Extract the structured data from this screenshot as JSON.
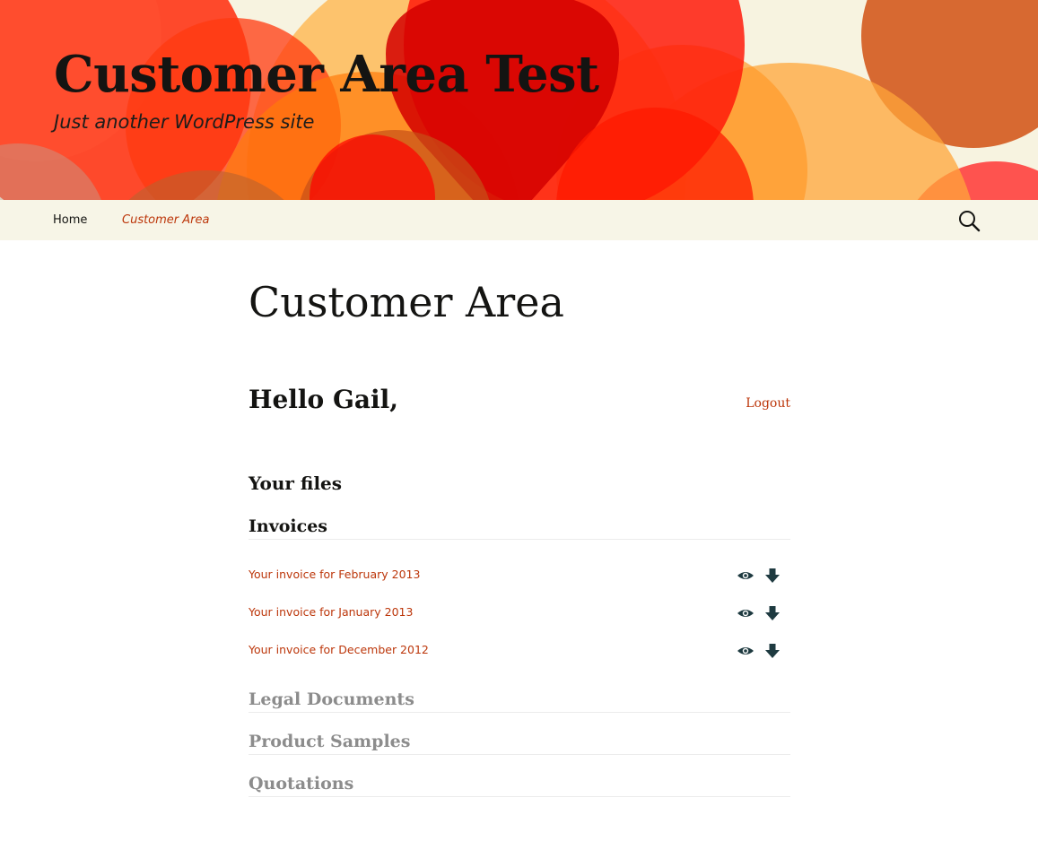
{
  "site": {
    "title": "Customer Area Test",
    "description": "Just another WordPress site"
  },
  "nav": {
    "items": [
      {
        "label": "Home"
      },
      {
        "label": "Customer Area"
      }
    ],
    "search_icon": "search-icon"
  },
  "page": {
    "title": "Customer Area",
    "greeting": "Hello Gail,",
    "logout_label": "Logout",
    "files_heading": "Your files"
  },
  "categories": [
    {
      "name": "Invoices",
      "files": [
        {
          "title": "Your invoice for February 2013"
        },
        {
          "title": "Your invoice for January 2013"
        },
        {
          "title": "Your invoice for December 2012"
        }
      ]
    },
    {
      "name": "Legal Documents"
    },
    {
      "name": "Product Samples"
    },
    {
      "name": "Quotations"
    }
  ],
  "icons": {
    "view": "eye-icon",
    "download": "download-arrow-icon"
  },
  "colors": {
    "link": "#bc360a",
    "nav_bg": "#f7f5e7",
    "text": "#141412",
    "collapsed_heading": "#8c8c8c",
    "icon": "#1e3a40"
  }
}
